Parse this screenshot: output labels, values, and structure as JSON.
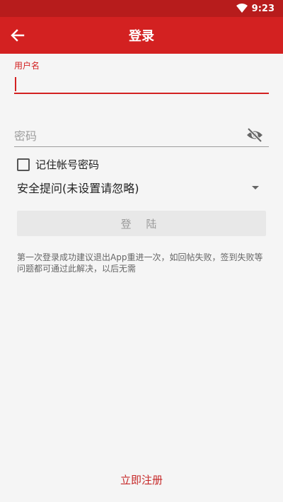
{
  "status_bar": {
    "time": "9:23"
  },
  "toolbar": {
    "title": "登录"
  },
  "form": {
    "username_label": "用户名",
    "password_placeholder": "密码",
    "remember_label": "记住帐号密码",
    "security_question": "安全提问(未设置请忽略)",
    "login_button": "登 陆"
  },
  "hint": "第一次登录成功建议退出App重进一次，如回帖失败，签到失败等问题都可通过此解决，以后无需",
  "register_link": "立即注册",
  "colors": {
    "primary": "#d32121",
    "status_bar": "#b71c1c",
    "background": "#f5f5f5"
  }
}
